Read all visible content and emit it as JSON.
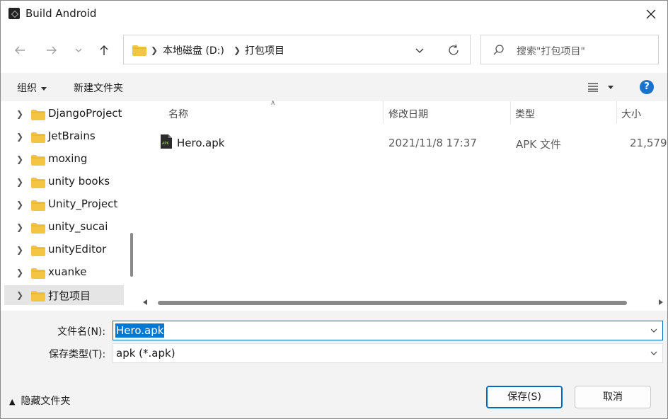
{
  "window": {
    "title": "Build Android"
  },
  "address": {
    "segments": [
      "本地磁盘 (D:)",
      "打包项目"
    ]
  },
  "search": {
    "placeholder": "搜索\"打包项目\""
  },
  "toolbar": {
    "organize": "组织",
    "new_folder": "新建文件夹"
  },
  "sidebar": {
    "items": [
      {
        "label": "DjangoProject"
      },
      {
        "label": "JetBrains"
      },
      {
        "label": "moxing"
      },
      {
        "label": "unity books"
      },
      {
        "label": "Unity_Project"
      },
      {
        "label": "unity_sucai"
      },
      {
        "label": "unityEditor"
      },
      {
        "label": "xuanke"
      },
      {
        "label": "打包项目"
      }
    ],
    "selected": "打包项目"
  },
  "columns": {
    "name": "名称",
    "modified": "修改日期",
    "type": "类型",
    "size": "大小"
  },
  "files": [
    {
      "name": "Hero.apk",
      "modified": "2021/11/8 17:37",
      "type": "APK 文件",
      "size": "21,579"
    }
  ],
  "form": {
    "filename_label": "文件名(N):",
    "filename_value": "Hero.apk",
    "filetype_label": "保存类型(T):",
    "filetype_value": "apk (*.apk)",
    "hide_folders": "隐藏文件夹",
    "save": "保存(S)",
    "cancel": "取消"
  },
  "colors": {
    "accent": "#0078d4",
    "folder": "#f4c542"
  }
}
